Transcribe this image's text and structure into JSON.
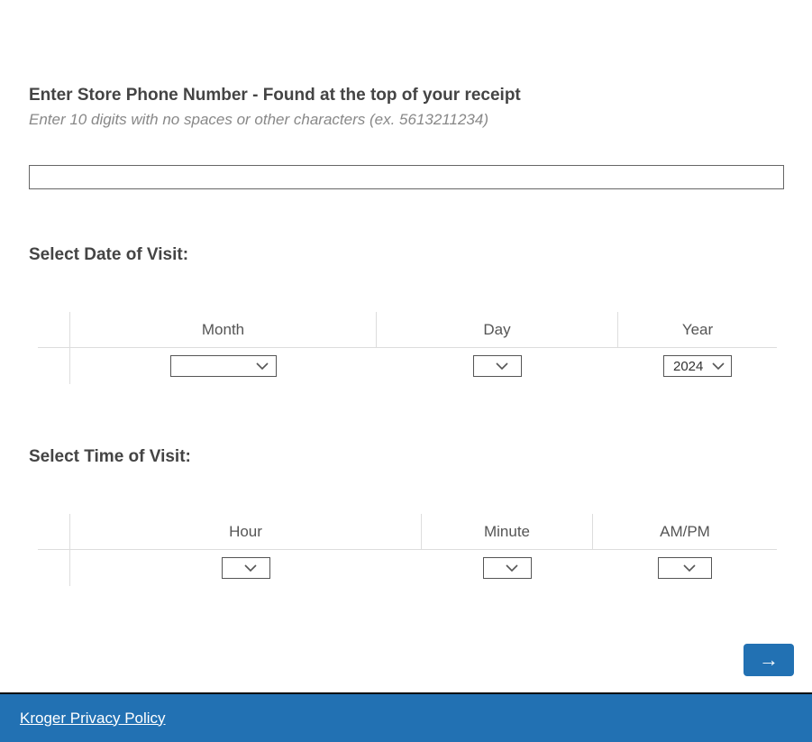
{
  "phone_section": {
    "heading": "Enter Store Phone Number - Found at the top of your receipt",
    "subheading": "Enter 10 digits with no spaces or other characters (ex. 5613211234)",
    "value": ""
  },
  "date_section": {
    "label": "Select Date of Visit:",
    "headers": {
      "month": "Month",
      "day": "Day",
      "year": "Year"
    },
    "values": {
      "month": "",
      "day": "",
      "year": "2024"
    }
  },
  "time_section": {
    "label": "Select Time of Visit:",
    "headers": {
      "hour": "Hour",
      "minute": "Minute",
      "ampm": "AM/PM"
    },
    "values": {
      "hour": "",
      "minute": "",
      "ampm": ""
    }
  },
  "next_button": {
    "arrow": "→"
  },
  "footer": {
    "privacy_link": "Kroger Privacy Policy"
  }
}
